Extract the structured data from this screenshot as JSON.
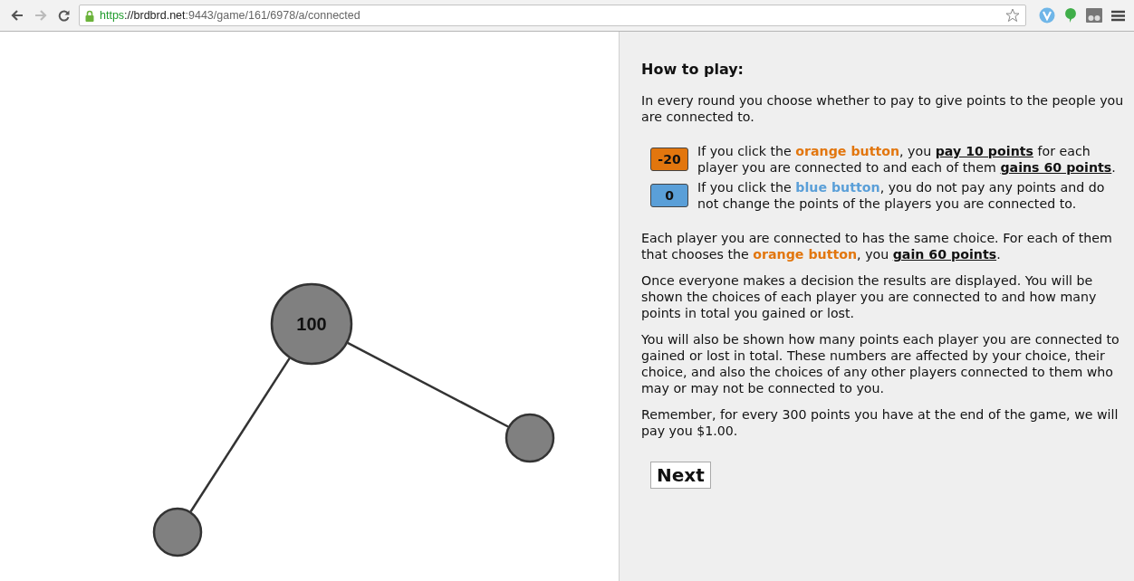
{
  "browser": {
    "url_scheme": "https",
    "url_host": "://brdbrd.net",
    "url_rest": ":9443/game/161/6978/a/connected"
  },
  "graph": {
    "nodes": [
      {
        "kind": "player",
        "label": "100"
      },
      {
        "kind": "player"
      },
      {
        "kind": "player"
      }
    ]
  },
  "instructions": {
    "title": "How to play:",
    "intro": [
      {
        "text": "In every round you choose whether to pay to give points to the people you are connected to.",
        "kind": "plain"
      }
    ],
    "options": [
      {
        "kind": "orange",
        "button": "-20",
        "text": [
          {
            "text": "If you click the ",
            "kind": "plain"
          },
          {
            "text": "orange button",
            "kind": "orange"
          },
          {
            "text": ", you ",
            "kind": "plain"
          },
          {
            "text": "pay 10 points",
            "kind": "strong"
          },
          {
            "text": " for each player you are connected to and each of them ",
            "kind": "plain"
          },
          {
            "text": "gains 60 points",
            "kind": "strong"
          },
          {
            "text": ".",
            "kind": "plain"
          }
        ]
      },
      {
        "kind": "blue",
        "button": "0",
        "text": [
          {
            "text": "If you click the ",
            "kind": "plain"
          },
          {
            "text": "blue button",
            "kind": "blue"
          },
          {
            "text": ", you do not pay any points and do not change the points of the players you are connected to.",
            "kind": "plain"
          }
        ]
      }
    ],
    "paragraphs": [
      [
        {
          "text": "Each player you are connected to has the same choice. For each of them that chooses the ",
          "kind": "plain"
        },
        {
          "text": "orange button",
          "kind": "orange"
        },
        {
          "text": ", you ",
          "kind": "plain"
        },
        {
          "text": "gain 60 points",
          "kind": "strong"
        },
        {
          "text": ".",
          "kind": "plain"
        }
      ],
      [
        {
          "text": "Once everyone makes a decision the results are displayed. You will be shown the choices of each player you are connected to and how many points in total you gained or lost.",
          "kind": "plain"
        }
      ],
      [
        {
          "text": "You will also be shown how many points each player you are connected to gained or lost in total. These numbers are affected by your choice, their choice, and also the choices of any other players connected to them who may or may not be connected to you.",
          "kind": "plain"
        }
      ],
      [
        {
          "text": "Remember, for every 300 points you have at the end of the game, we will pay you $1.00.",
          "kind": "plain"
        }
      ]
    ],
    "next_button": "Next"
  }
}
